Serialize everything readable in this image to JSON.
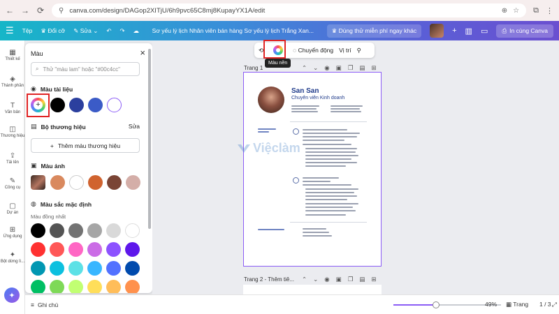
{
  "browser": {
    "url": "canva.com/design/DAGop2XITjU/6h9pvc65C8mj8KupayYX1A/edit"
  },
  "header": {
    "home": "Tệp",
    "resize": "Đổi cỡ",
    "edit": "Sửa",
    "doc_title": "Sơ yếu lý lịch Nhân viên bán hàng Sơ yếu lý lịch Trắng Xan...",
    "trial": "Dùng thử miễn phí ngay khác",
    "print": "In cùng Canva"
  },
  "rail": [
    {
      "label": "Thiết kế",
      "icon": "layout-icon"
    },
    {
      "label": "Thành phần",
      "icon": "shapes-icon"
    },
    {
      "label": "Văn bản",
      "icon": "text-icon"
    },
    {
      "label": "Thương hiệu",
      "icon": "brand-icon"
    },
    {
      "label": "Tải lên",
      "icon": "upload-icon"
    },
    {
      "label": "Công cụ",
      "icon": "tools-icon"
    },
    {
      "label": "Dự án",
      "icon": "folder-icon"
    },
    {
      "label": "Ứng dụng",
      "icon": "apps-icon"
    },
    {
      "label": "Bột dừng lì...",
      "icon": "magic-icon"
    }
  ],
  "panel": {
    "title": "Màu",
    "search_placeholder": "Thử \"màu lam\" hoặc \"#00c4cc\"",
    "doc_colors_title": "Màu tài liệu",
    "doc_colors": [
      "#000000",
      "#2b3f9e",
      "#3b5bc7",
      "#ffffff"
    ],
    "brand_title": "Bộ thương hiệu",
    "brand_action": "Sửa",
    "brand_button": "Thêm màu thương hiệu",
    "photo_title": "Màu ảnh",
    "photo_colors": [
      "#d9895e",
      "#ffffff",
      "#d0632f",
      "#7a4435",
      "#d4aea8"
    ],
    "default_title": "Màu sắc mặc định",
    "default_subtitle": "Màu đồng nhất",
    "default_colors": [
      [
        "#000000",
        "#545454",
        "#737373",
        "#a6a6a6",
        "#d9d9d9",
        "#ffffff"
      ],
      [
        "#ff3131",
        "#ff5757",
        "#ff66c4",
        "#cb6ce6",
        "#8c52ff",
        "#5e17eb"
      ],
      [
        "#0097b2",
        "#0cc0df",
        "#5ce1e6",
        "#38b6ff",
        "#5271ff",
        "#004aad"
      ],
      [
        "#00bf63",
        "#7ed957",
        "#c1ff72",
        "#ffde59",
        "#ffbd59",
        "#ff914d"
      ]
    ]
  },
  "context_toolbar": {
    "animate": "Chuyển động",
    "position": "Vị trí"
  },
  "tooltip": "Màu nền",
  "page1_label": "Trang 1",
  "page2_label": "Trang 2 - Thêm tiê...",
  "resume": {
    "name": "San San",
    "role": "Chuyên viên Kinh doanh"
  },
  "watermark": "Việclàm",
  "bottom": {
    "notes": "Ghi chú",
    "zoom": "49%",
    "zoom_level": 0.49,
    "pages": "Trang",
    "page_count": "1 / 3"
  }
}
